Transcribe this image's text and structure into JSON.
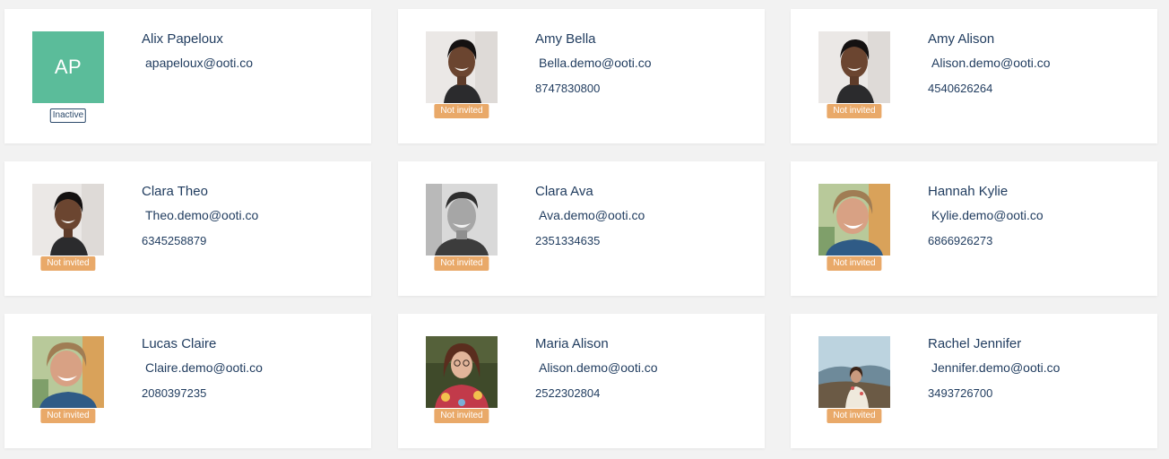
{
  "colors": {
    "page_background": "#f2f2f2",
    "card_background": "#ffffff",
    "text": "#1f3b5e",
    "initials_avatar": "#5bbc9a",
    "not_invited_badge": "#e9a969",
    "inactive_badge_border": "#2c4a6b"
  },
  "users": [
    {
      "id": "alix-papeloux",
      "name": "Alix Papeloux",
      "email": "apapeloux@ooti.co",
      "phone": "",
      "status": "Inactive",
      "avatar": {
        "kind": "initials",
        "initials": "AP"
      }
    },
    {
      "id": "amy-bella",
      "name": "Amy Bella",
      "email": "Bella.demo@ooti.co",
      "phone": "8747830800",
      "status": "Not invited",
      "avatar": {
        "kind": "photo",
        "photo": "woman-dark-hair-smiling"
      }
    },
    {
      "id": "amy-alison",
      "name": "Amy Alison",
      "email": "Alison.demo@ooti.co",
      "phone": "4540626264",
      "status": "Not invited",
      "avatar": {
        "kind": "photo",
        "photo": "woman-dark-hair-smiling"
      }
    },
    {
      "id": "clara-theo",
      "name": "Clara Theo",
      "email": "Theo.demo@ooti.co",
      "phone": "6345258879",
      "status": "Not invited",
      "avatar": {
        "kind": "photo",
        "photo": "woman-dark-hair-smiling"
      }
    },
    {
      "id": "clara-ava",
      "name": "Clara Ava",
      "email": "Ava.demo@ooti.co",
      "phone": "2351334635",
      "status": "Not invited",
      "avatar": {
        "kind": "photo",
        "photo": "man-grayscale-smiling"
      }
    },
    {
      "id": "hannah-kylie",
      "name": "Hannah Kylie",
      "email": "Kylie.demo@ooti.co",
      "phone": "6866926273",
      "status": "Not invited",
      "avatar": {
        "kind": "photo",
        "photo": "woman-blonde-laughing"
      }
    },
    {
      "id": "lucas-claire",
      "name": "Lucas Claire",
      "email": "Claire.demo@ooti.co",
      "phone": "2080397235",
      "status": "Not invited",
      "avatar": {
        "kind": "photo",
        "photo": "woman-blonde-laughing"
      }
    },
    {
      "id": "maria-alison",
      "name": "Maria Alison",
      "email": "Alison.demo@ooti.co",
      "phone": "2522302804",
      "status": "Not invited",
      "avatar": {
        "kind": "photo",
        "photo": "woman-glasses-floral-shirt"
      }
    },
    {
      "id": "rachel-jennifer",
      "name": "Rachel Jennifer",
      "email": "Jennifer.demo@ooti.co",
      "phone": "3493726700",
      "status": "Not invited",
      "avatar": {
        "kind": "photo",
        "photo": "woman-landscape-outdoor"
      }
    }
  ]
}
